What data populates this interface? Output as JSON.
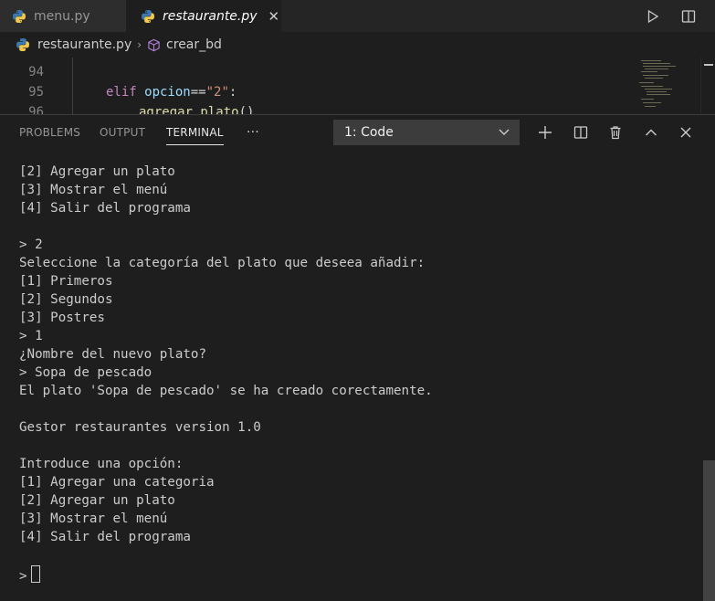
{
  "tabs": [
    {
      "label": "menu.py",
      "icon": "python-icon"
    },
    {
      "label": "restaurante.py",
      "icon": "python-icon",
      "close": "✕"
    }
  ],
  "editor_actions": [
    "run-icon",
    "split-editor-icon"
  ],
  "breadcrumbs": {
    "file": "restaurante.py",
    "separator": "›",
    "symbol": "crear_bd"
  },
  "editor": {
    "lines": [
      {
        "number": "94"
      },
      {
        "number": "95",
        "keyword": "elif",
        "var": " opcion",
        "op": "==",
        "str": "\"2\"",
        "colon": ":"
      },
      {
        "number": "96",
        "fn": "agregar_plato",
        "paren": "()"
      }
    ]
  },
  "panel": {
    "tabs": [
      "PROBLEMS",
      "OUTPUT",
      "TERMINAL",
      "···"
    ],
    "active_tab": "TERMINAL",
    "terminal_select": "1: Code",
    "actions": [
      "add-terminal-icon",
      "split-terminal-icon",
      "trash-icon",
      "maximize-panel-icon",
      "close-panel-icon"
    ]
  },
  "terminal": {
    "lines": [
      "[2] Agregar un plato",
      "[3] Mostrar el menú",
      "[4] Salir del programa",
      "",
      "> 2",
      "Seleccione la categoría del plato que deseea añadir:",
      "[1] Primeros",
      "[2] Segundos",
      "[3] Postres",
      "> 1",
      "¿Nombre del nuevo plato?",
      "> Sopa de pescado",
      "El plato 'Sopa de pescado' se ha creado corectamente.",
      "",
      "Gestor restaurantes version 1.0",
      "",
      "Introduce una opción:",
      "[1] Agregar una categoria",
      "[2] Agregar un plato",
      "[3] Mostrar el menú",
      "[4] Salir del programa",
      ""
    ],
    "prompt": ">"
  },
  "colors": {
    "keyword": "#c586c0",
    "string": "#ce9178",
    "function": "#dcdcaa",
    "accent": "#e7e7e7"
  }
}
